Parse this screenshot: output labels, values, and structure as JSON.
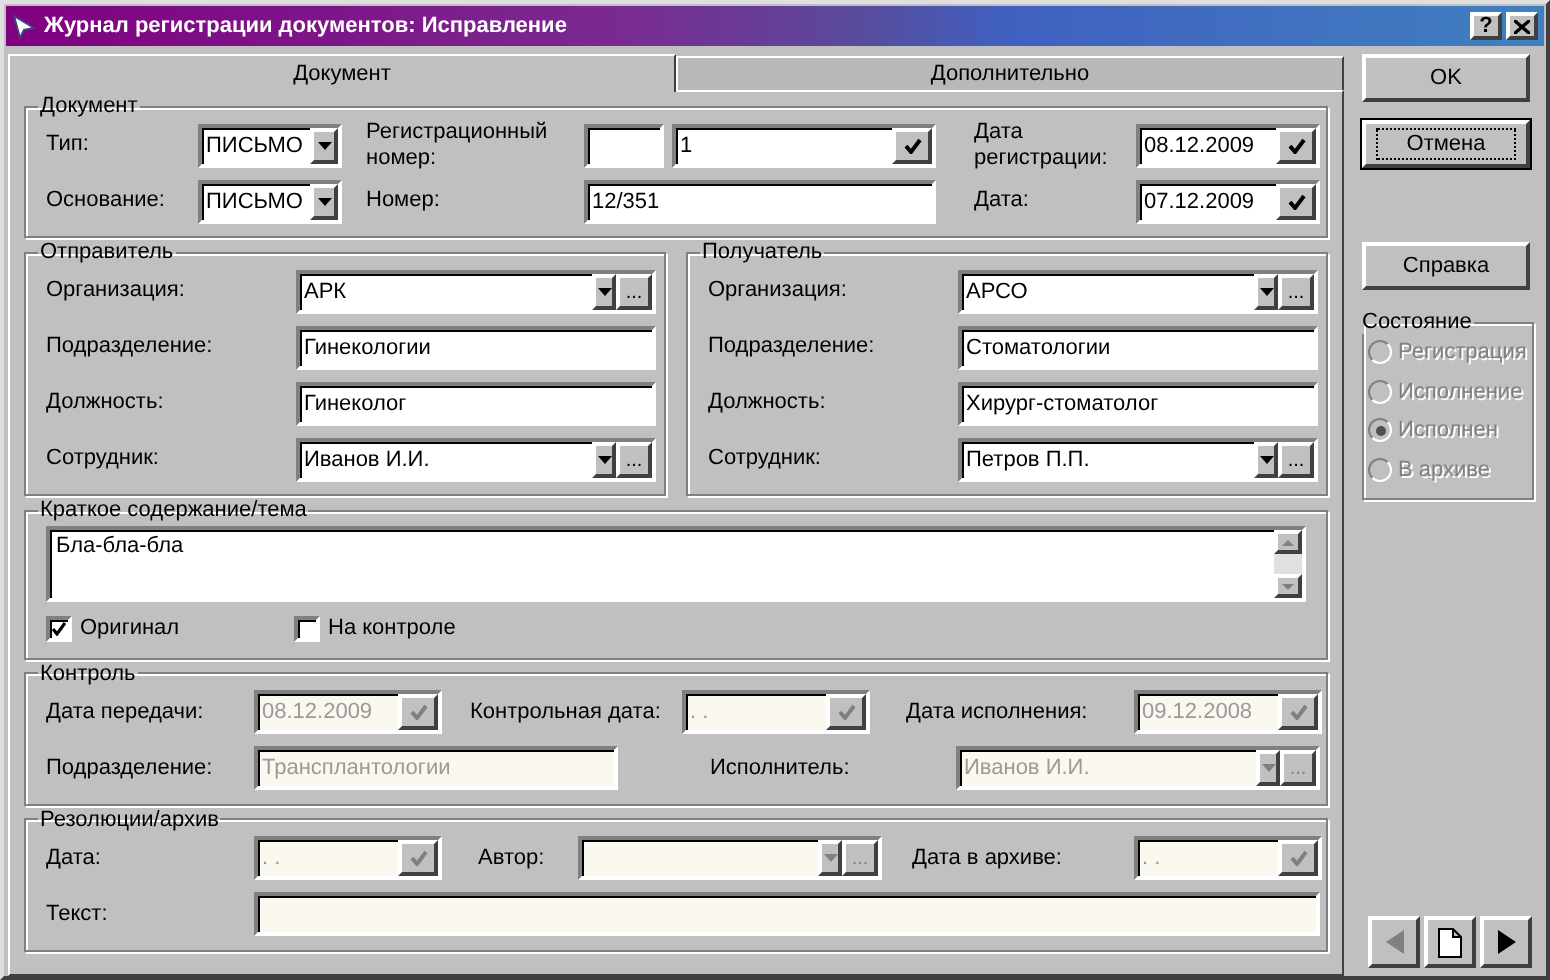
{
  "window": {
    "title": "Журнал регистрации документов: Исправление",
    "help_label": "?"
  },
  "tabs": [
    {
      "label": "Документ",
      "selected": true
    },
    {
      "label": "Дополнительно",
      "selected": false
    }
  ],
  "document": {
    "legend": "Документ",
    "rows": [
      [
        {
          "label": "Тип:",
          "fields": [
            {
              "kind": "dropdown",
              "value": "ПИСЬМО",
              "disabled": false
            }
          ]
        },
        {
          "label": "Регистрационный номер:",
          "fields": [
            {
              "kind": "text",
              "disabled": false
            },
            {
              "kind": "check",
              "value": "1",
              "disabled": false
            }
          ]
        },
        {
          "label": "Дата регистрации:",
          "fields": [
            {
              "kind": "check",
              "value": "08.12.2009",
              "disabled": false
            }
          ]
        }
      ],
      [
        {
          "label": "Основание:",
          "fields": [
            {
              "kind": "dropdown",
              "value": "ПИСЬМО",
              "disabled": false
            }
          ]
        },
        {
          "label": "Номер:",
          "fields": [
            {
              "kind": "text",
              "value": "12/351",
              "disabled": false
            }
          ]
        },
        {
          "label": "Дата:",
          "fields": [
            {
              "kind": "check",
              "value": "07.12.2009",
              "disabled": false
            }
          ]
        }
      ]
    ]
  },
  "parties": [
    {
      "legend": "Отправитель",
      "rows": [
        [
          {
            "label": "Организация:",
            "fields": [
              {
                "kind": "lookup",
                "value": "АРК",
                "button_label": "...",
                "disabled": false
              }
            ]
          }
        ],
        [
          {
            "label": "Подразделение:",
            "fields": [
              {
                "kind": "text",
                "value": "Гинекологии",
                "disabled": false
              }
            ]
          }
        ],
        [
          {
            "label": "Должность:",
            "fields": [
              {
                "kind": "text",
                "value": "Гинеколог",
                "disabled": false
              }
            ]
          }
        ],
        [
          {
            "label": "Сотрудник:",
            "fields": [
              {
                "kind": "lookup",
                "value": "Иванов И.И.",
                "button_label": "...",
                "disabled": false
              }
            ]
          }
        ]
      ]
    },
    {
      "legend": "Получатель",
      "rows": [
        [
          {
            "label": "Организация:",
            "fields": [
              {
                "kind": "lookup",
                "value": "АРСО",
                "button_label": "...",
                "disabled": false
              }
            ]
          }
        ],
        [
          {
            "label": "Подразделение:",
            "fields": [
              {
                "kind": "text",
                "value": "Стоматологии",
                "disabled": false
              }
            ]
          }
        ],
        [
          {
            "label": "Должность:",
            "fields": [
              {
                "kind": "text",
                "value": "Хирург-стоматолог",
                "disabled": false
              }
            ]
          }
        ],
        [
          {
            "label": "Сотрудник:",
            "fields": [
              {
                "kind": "lookup",
                "value": "Петров П.П.",
                "button_label": "...",
                "disabled": false
              }
            ]
          }
        ]
      ]
    }
  ],
  "summary": {
    "legend": "Краткое содержание/тема",
    "text": "Бла-бла-бла",
    "checkboxes": [
      {
        "label": "Оригинал",
        "checked": true
      },
      {
        "label": "На контроле",
        "checked": false
      }
    ]
  },
  "control": {
    "legend": "Контроль",
    "dates": [
      {
        "label": "Дата передачи:",
        "fields": [
          {
            "kind": "check",
            "value": "08.12.2009",
            "disabled": true
          }
        ]
      },
      {
        "label": "Контрольная дата:",
        "fields": [
          {
            "kind": "check",
            "value": ". .",
            "disabled": true
          }
        ]
      },
      {
        "label": "Дата исполнения:",
        "fields": [
          {
            "kind": "check",
            "value": "09.12.2008",
            "disabled": true
          }
        ]
      }
    ],
    "assignment": [
      {
        "label": "Подразделение:",
        "fields": [
          {
            "kind": "text",
            "value": "Трансплантологии",
            "disabled": true
          }
        ]
      },
      {
        "label": "Исполнитель:",
        "fields": [
          {
            "kind": "lookup",
            "value": "Иванов И.И.",
            "button_label": "...",
            "disabled": true
          }
        ]
      }
    ]
  },
  "resolutions": {
    "legend": "Резолюции/архив",
    "rows": [
      [
        {
          "label": "Дата:",
          "fields": [
            {
              "kind": "check",
              "value": ". .",
              "disabled": true
            }
          ]
        },
        {
          "label": "Автор:",
          "fields": [
            {
              "kind": "lookup",
              "button_label": "...",
              "disabled": true
            }
          ]
        },
        {
          "label": "Дата в архиве:",
          "fields": [
            {
              "kind": "check",
              "value": ". .",
              "disabled": true
            }
          ]
        }
      ],
      [
        {
          "label": "Текст:",
          "fields": [
            {
              "kind": "text",
              "disabled": true
            }
          ]
        }
      ]
    ]
  },
  "buttons": [
    {
      "label": "OK",
      "focused": false
    },
    {
      "label": "Отмена",
      "focused": true
    }
  ],
  "help_button": {
    "label": "Справка",
    "focused": false
  },
  "status": {
    "legend": "Состояние",
    "options": [
      {
        "label": "Регистрация",
        "selected": false,
        "disabled": true
      },
      {
        "label": "Исполнение",
        "selected": false,
        "disabled": true
      },
      {
        "label": "Исполнен",
        "selected": true,
        "disabled": true
      },
      {
        "label": "В архиве",
        "selected": false,
        "disabled": true
      }
    ]
  },
  "nav": [
    {
      "kind": "prev",
      "disabled": true
    },
    {
      "kind": "new",
      "disabled": false
    },
    {
      "kind": "next",
      "disabled": false
    }
  ]
}
